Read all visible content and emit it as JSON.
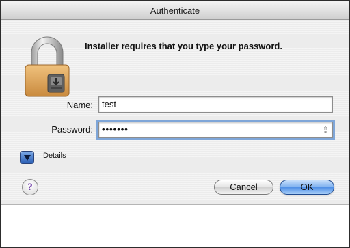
{
  "window": {
    "title": "Authenticate"
  },
  "dialog": {
    "prompt": "Installer requires that you type your password.",
    "name_label": "Name:",
    "name_value": "test",
    "password_label": "Password:",
    "password_value": "•••••••",
    "details_label": "Details",
    "help_label": "?",
    "cancel_label": "Cancel",
    "ok_label": "OK"
  },
  "icons": {
    "lock": "padlock-icon",
    "capslock": "capslock-icon",
    "disclosure": "disclosure-triangle-icon"
  },
  "colors": {
    "accent": "#4f8fe6",
    "focus_ring": "#7fa6d8",
    "lock_body": "#d9a35a"
  }
}
